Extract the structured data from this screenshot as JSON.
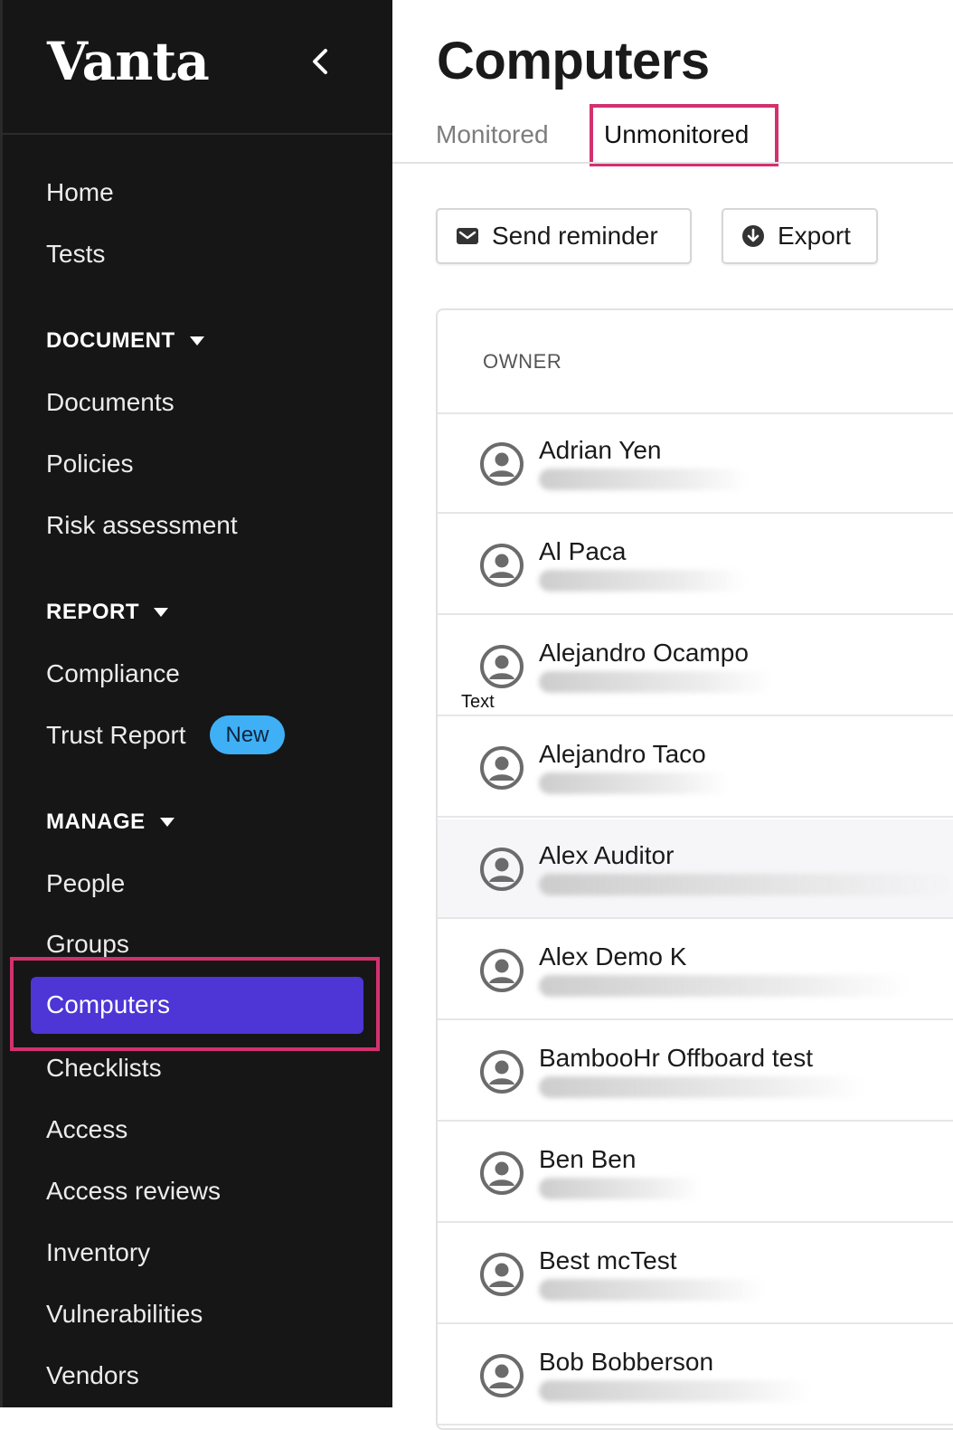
{
  "sidebar": {
    "brand": "Vanta",
    "collapse_icon": "chevron-left-icon",
    "items_top": [
      "Home",
      "Tests"
    ],
    "sections": {
      "document": {
        "title": "DOCUMENT",
        "items": [
          "Documents",
          "Policies",
          "Risk assessment"
        ]
      },
      "report": {
        "title": "REPORT",
        "items": [
          "Compliance",
          "Trust Report"
        ],
        "badge": "New"
      },
      "manage": {
        "title": "MANAGE",
        "items": [
          "People",
          "Groups",
          "Computers",
          "Checklists",
          "Access",
          "Access reviews",
          "Inventory",
          "Vulnerabilities",
          "Vendors"
        ],
        "active": "Computers"
      }
    }
  },
  "main": {
    "title": "Computers",
    "tabs": [
      {
        "label": "Monitored",
        "active": false
      },
      {
        "label": "Unmonitored",
        "active": true
      }
    ],
    "buttons": {
      "send_reminder": {
        "label": "Send reminder",
        "icon": "envelope-icon"
      },
      "export": {
        "label": "Export",
        "icon": "download-icon"
      }
    },
    "table": {
      "column": "OWNER",
      "rows": [
        {
          "name": "Adrian Yen"
        },
        {
          "name": "Al Paca"
        },
        {
          "name": "Alejandro Ocampo"
        },
        {
          "name": "Alejandro Taco"
        },
        {
          "name": "Alex Auditor"
        },
        {
          "name": "Alex Demo K"
        },
        {
          "name": "BambooHr Offboard test"
        },
        {
          "name": "Ben Ben"
        },
        {
          "name": "Best mcTest"
        },
        {
          "name": "Bob Bobberson"
        }
      ]
    },
    "tooltip": "Text"
  },
  "colors": {
    "sidebar_bg": "#161616",
    "active_item": "#4d35d6",
    "highlight": "#d2316f",
    "badge": "#3fb0f6"
  }
}
